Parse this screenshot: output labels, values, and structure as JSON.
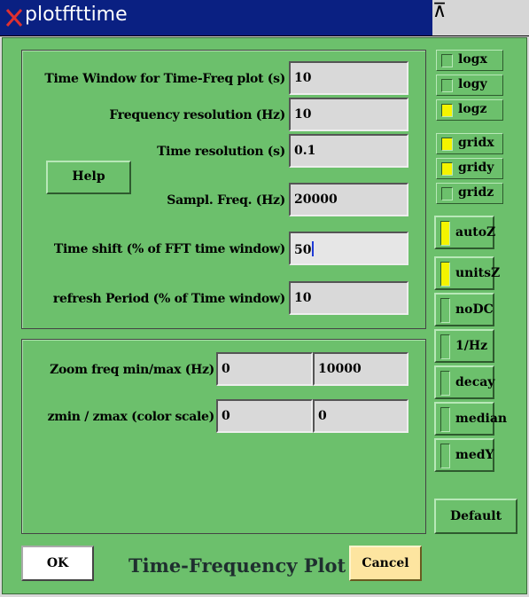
{
  "window": {
    "title": "plotffttime",
    "controls": [
      "⊼",
      "_",
      "□",
      "✕"
    ]
  },
  "params": [
    {
      "label": "Time Window for Time-Freq plot (s)",
      "value": "10"
    },
    {
      "label": "Frequency resolution (Hz)",
      "value": "10"
    },
    {
      "label": "Time resolution (s)",
      "value": "0.1"
    },
    {
      "label": "Sampl. Freq. (Hz)",
      "value": "20000"
    },
    {
      "label": "Time shift (% of FFT time window)",
      "value": "50"
    },
    {
      "label": "refresh Period (% of Time window)",
      "value": "10"
    }
  ],
  "help_label": "Help",
  "zoom": {
    "label": "Zoom freq min/max (Hz)",
    "min": "0",
    "max": "10000"
  },
  "zrange": {
    "label": "zmin / zmax (color scale)",
    "min": "0",
    "max": "0"
  },
  "checks": [
    {
      "label": "logx",
      "checked": false
    },
    {
      "label": "logy",
      "checked": false
    },
    {
      "label": "logz",
      "checked": true
    },
    {
      "label": "gridx",
      "checked": true
    },
    {
      "label": "gridy",
      "checked": true
    },
    {
      "label": "gridz",
      "checked": false
    }
  ],
  "toggles": [
    {
      "label": "autoZ",
      "on": true
    },
    {
      "label": "unitsZ",
      "on": true
    },
    {
      "label": "noDC",
      "on": false
    },
    {
      "label": "1/Hz",
      "on": false
    },
    {
      "label": "decay",
      "on": false
    },
    {
      "label": "median",
      "on": false
    },
    {
      "label": "medY",
      "on": false
    }
  ],
  "default_label": "Default",
  "ok_label": "OK",
  "main_title": "Time-Frequency Plot",
  "cancel_label": "Cancel",
  "colors": {
    "window_bg": "#6cc06c",
    "titlebar": "#0a2082",
    "checked": "#f4f400",
    "cancel_bg": "#fde5a0"
  }
}
